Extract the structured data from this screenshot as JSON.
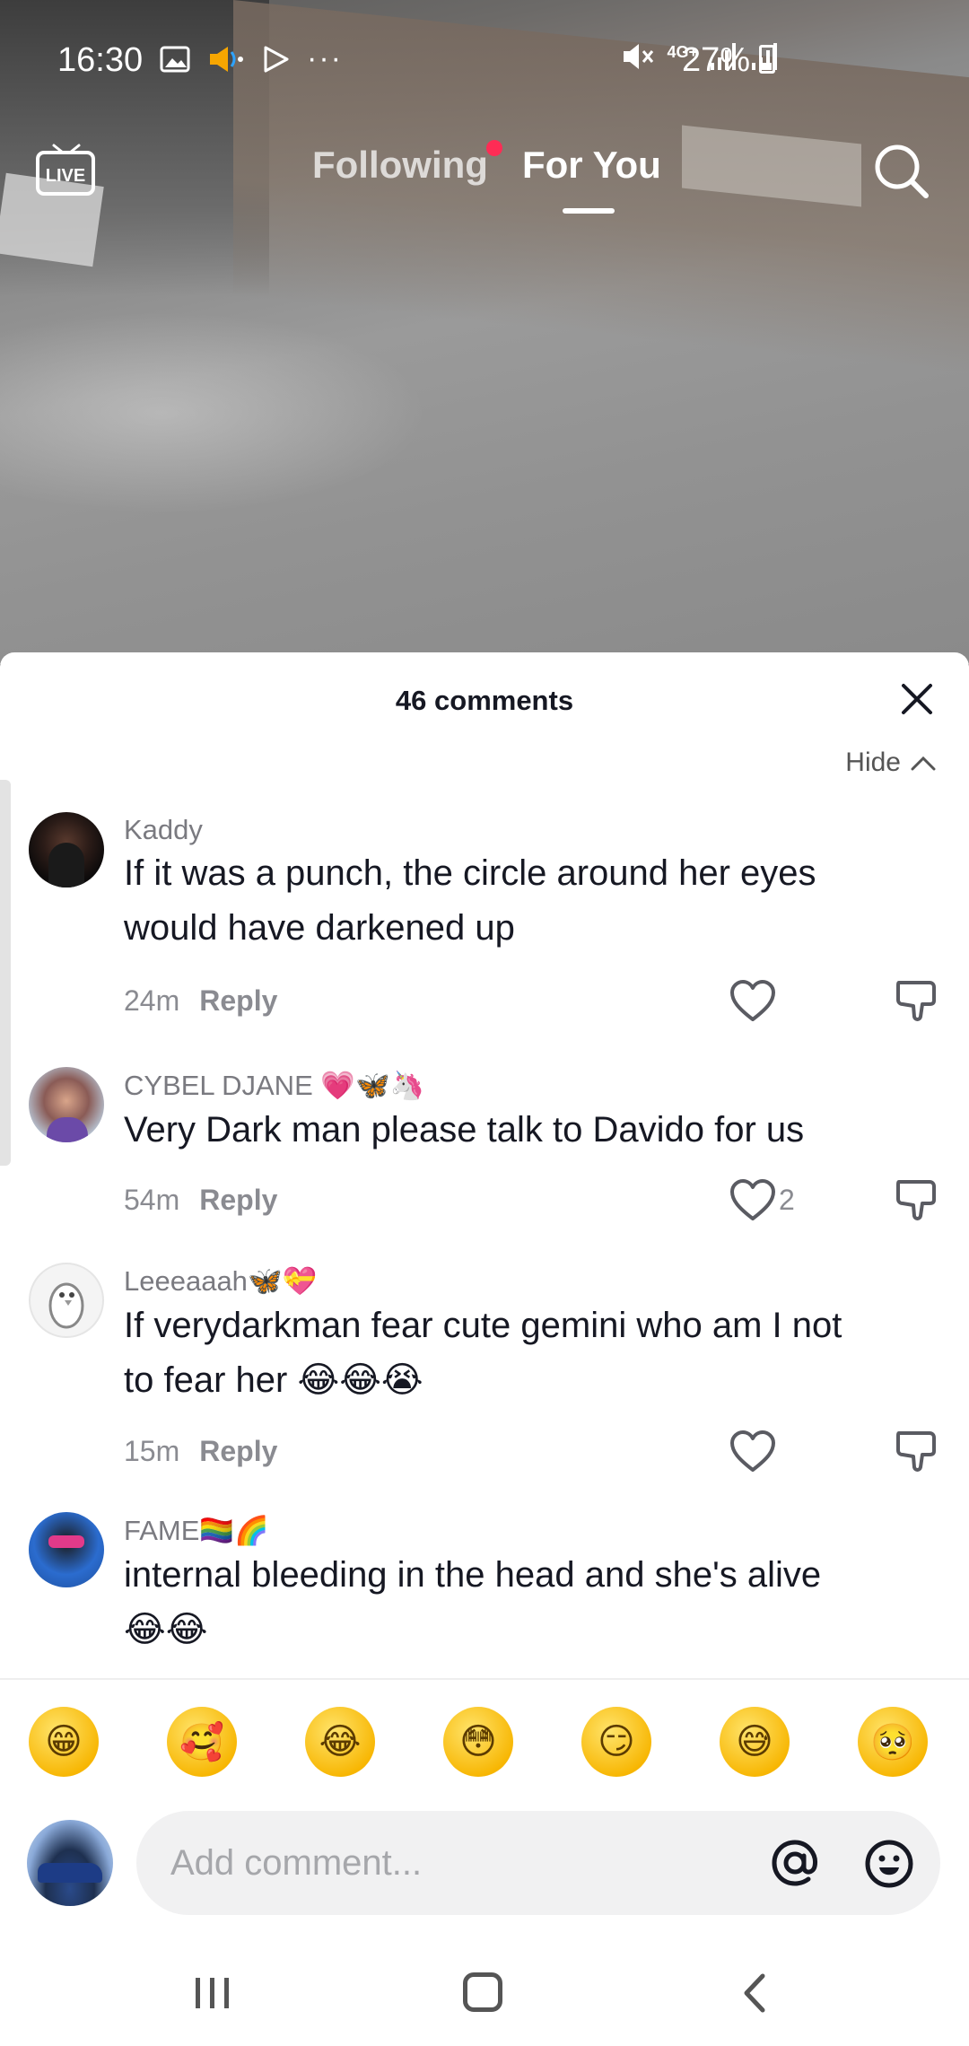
{
  "status_bar": {
    "time": "16:30",
    "left_icons": [
      "gallery-icon",
      "speaker-icon",
      "play-store-icon",
      "more-dots-icon"
    ],
    "more_dots": "···",
    "network_label": "4G+",
    "battery": "27%"
  },
  "top_nav": {
    "live_label": "LIVE",
    "tab_following": "Following",
    "tab_for_you": "For You",
    "active_tab": "For You",
    "accent_color": "#fe2c55"
  },
  "comments_sheet": {
    "title": "46 comments",
    "hide_label": "Hide",
    "comments": [
      {
        "username": "Kaddy",
        "text": "If it was a punch, the circle around her eyes would have darkened up",
        "age": "24m",
        "reply_label": "Reply",
        "likes": ""
      },
      {
        "username": "CYBEL DJANE",
        "name_emojis": "💗🦋🦄",
        "text": "Very Dark man please talk to Davido for us",
        "age": "54m",
        "reply_label": "Reply",
        "likes": "2"
      },
      {
        "username": "Leeeaaah",
        "name_emojis": "🦋💝",
        "text": "If verydarkman fear cute gemini who am I not to fear her",
        "text_emojis": "😂😂😭",
        "age": "15m",
        "reply_label": "Reply",
        "likes": ""
      },
      {
        "username": "FAME",
        "name_emojis": "🏳️‍🌈🌈",
        "text": "internal bleeding in the head and she's alive",
        "text_emojis": "😂😂"
      }
    ]
  },
  "quick_emojis": [
    "😁",
    "🥰",
    "😂",
    "😳",
    "😏",
    "😅",
    "🥺"
  ],
  "comment_input": {
    "placeholder": "Add comment..."
  }
}
